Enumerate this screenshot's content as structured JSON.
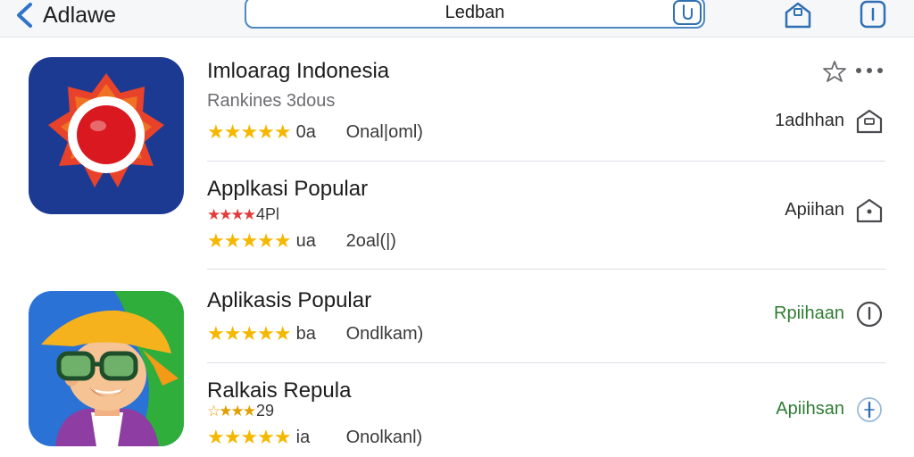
{
  "header": {
    "back_label": "Adlawe",
    "search_value": "Ledban"
  },
  "apps": [
    {
      "title": "Imloarag Indonesia",
      "subtitle": "Rankines 3dous",
      "stars": "★★★★★",
      "rating_count": "0a",
      "meta": "Onal|oml)",
      "action_label": "1adhhan"
    },
    {
      "title": "Applkasi Popular",
      "stars_small": "★★★★",
      "stars_small_value": "4Pl",
      "stars": "★★★★★",
      "rating_count": "ua",
      "meta": "2oal(|)",
      "action_label": "Apiihan"
    },
    {
      "title": "Aplikasis Popular",
      "stars": "★★★★★",
      "rating_count": "ba",
      "meta": "Ondlkam)",
      "action_label": "Rpiihaan"
    },
    {
      "title": "Ralkais Repula",
      "stars_small": "☆★★★",
      "stars_small_value": "29",
      "stars": "★★★★★",
      "rating_count": "ia",
      "meta": "Onolkanl)",
      "action_label": "Apiihsan"
    }
  ],
  "colors": {
    "accent": "#2f6fb3",
    "star": "#f5b800",
    "star_red": "#e23b3b",
    "action_green": "#2e7d32"
  }
}
